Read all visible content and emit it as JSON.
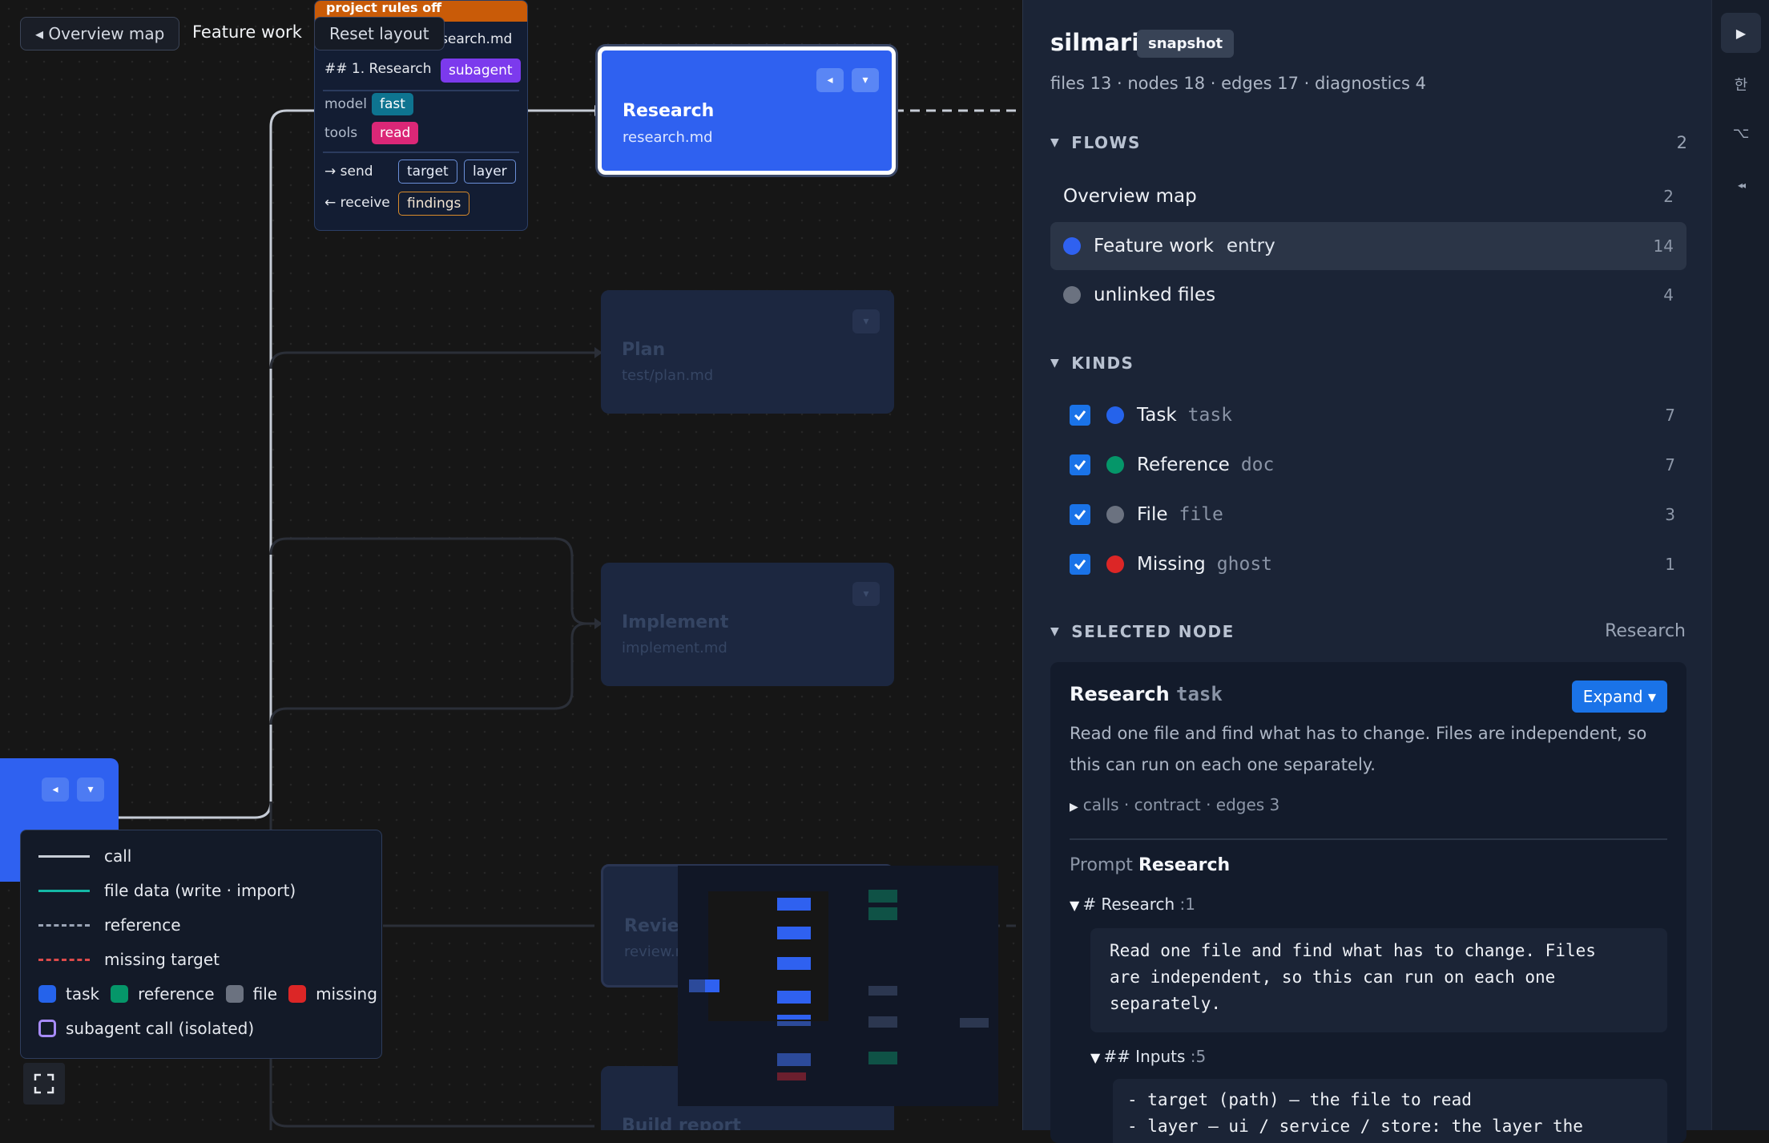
{
  "canvas": {
    "breadcrumb": {
      "back_label": "◂ Overview map",
      "current": "Feature work",
      "reset_label": "Reset layout"
    },
    "popup": {
      "banner": "project rules off",
      "file": "research.md",
      "heading": "## 1. Research",
      "badge": "subagent",
      "model_label": "model",
      "model_value": "fast",
      "tools_label": "tools",
      "tools_value": "read",
      "send_label": "→ send",
      "send_tags": [
        "target",
        "layer"
      ],
      "receive_label": "← receive",
      "receive_tags": [
        "findings"
      ]
    },
    "nodes": {
      "research": {
        "title": "Research",
        "file": "research.md"
      },
      "plan": {
        "title": "Plan",
        "file": "test/plan.md"
      },
      "implement": {
        "title": "Implement",
        "file": "implement.md"
      },
      "review": {
        "title": "Review",
        "file": "review.md"
      },
      "build": {
        "title": "Build report"
      }
    },
    "legend": {
      "call": "call",
      "file_data": "file data (write · import)",
      "reference": "reference",
      "missing_target": "missing target",
      "task": "task",
      "reference_kind": "reference",
      "file": "file",
      "missing": "missing",
      "subagent": "subagent call (isolated)"
    },
    "fullscreen_icon": "fullscreen-icon"
  },
  "panel": {
    "title": "silmari",
    "badge": "snapshot",
    "stats": "files 13 · nodes 18 · edges 17 · diagnostics 4",
    "flows": {
      "header": "FLOWS",
      "count": "2",
      "items": [
        {
          "label": "Overview map",
          "tag": "",
          "count": "2"
        },
        {
          "label": "Feature work",
          "tag": "entry",
          "count": "14"
        },
        {
          "label": "unlinked files",
          "tag": "",
          "count": "4"
        }
      ]
    },
    "kinds": {
      "header": "KINDS",
      "items": [
        {
          "label": "Task",
          "code": "task",
          "count": "7",
          "color": "#2563eb"
        },
        {
          "label": "Reference",
          "code": "doc",
          "count": "7",
          "color": "#059669"
        },
        {
          "label": "File",
          "code": "file",
          "count": "3",
          "color": "#6b7280"
        },
        {
          "label": "Missing",
          "code": "ghost",
          "count": "1",
          "color": "#dc2626"
        }
      ]
    },
    "selected": {
      "header": "SELECTED NODE",
      "value": "Research",
      "title": "Research",
      "kind": "task",
      "expand_label": "Expand ▾",
      "description": "Read one file and find what has to change. Files are independent, so this can run on each one separately.",
      "meta": "calls · contract · edges 3",
      "prompt_label": "Prompt",
      "prompt_name": "Research",
      "h1": "# Research",
      "h1_line": ":1",
      "code1": "Read one file and find what has to change. Files\nare independent, so this can run on each one\nseparately.",
      "h2": "## Inputs",
      "h2_line": ":5",
      "code2": "- target (path) — the file to read\n- layer — ui / service / store: the layer the"
    }
  },
  "rail": {
    "lang": "한",
    "alt": "⌥",
    "collapse": "◂◂"
  },
  "colors": {
    "accent": "#2563eb",
    "entry": "#2f61f0",
    "missing": "#dc2626",
    "reference": "#059669",
    "file": "#6b7280",
    "subagent": "#7c3aed"
  }
}
